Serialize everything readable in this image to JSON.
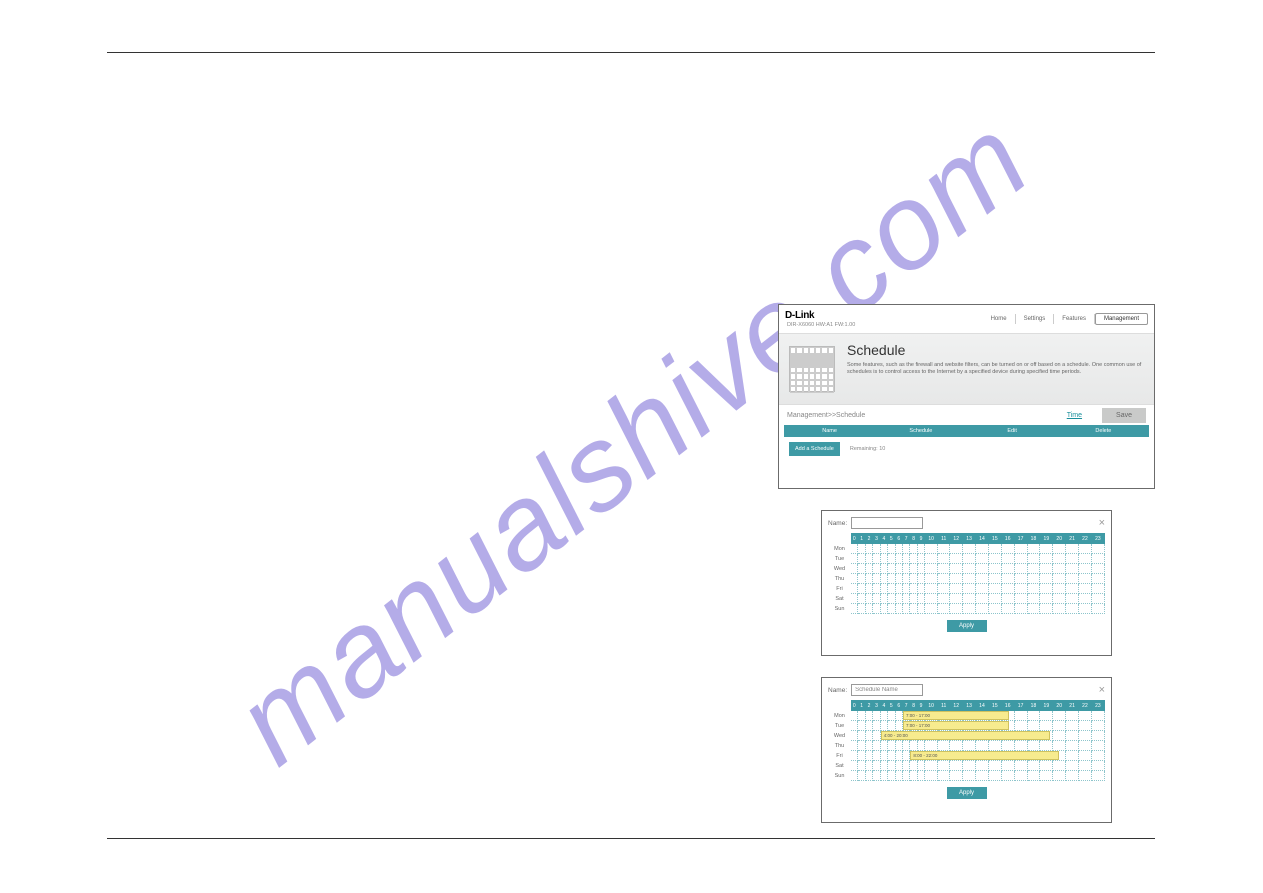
{
  "watermark": "manualshive.com",
  "panel1": {
    "logo": "D-Link",
    "model": "DIR-X6060 HW:A1 FW:1.00",
    "nav": {
      "home": "Home",
      "settings": "Settings",
      "features": "Features",
      "management": "Management"
    },
    "title": "Schedule",
    "description": "Some features, such as the firewall and website filters, can be turned on or off based on a schedule. One common use of schedules is to control access to the Internet by a specified device during specified time periods.",
    "breadcrumb": "Management>>Schedule",
    "time_link": "Time",
    "save_btn": "Save",
    "cols": {
      "name": "Name",
      "schedule": "Schedule",
      "edit": "Edit",
      "delete": "Delete"
    },
    "add_btn": "Add a Schedule",
    "remaining": "Remaining: 10"
  },
  "hours": [
    "0",
    "1",
    "2",
    "3",
    "4",
    "5",
    "6",
    "7",
    "8",
    "9",
    "10",
    "11",
    "12",
    "13",
    "14",
    "15",
    "16",
    "17",
    "18",
    "19",
    "20",
    "21",
    "22",
    "23"
  ],
  "days": [
    "Mon",
    "Tue",
    "Wed",
    "Thu",
    "Fri",
    "Sat",
    "Sun"
  ],
  "panel2": {
    "name_label": "Name:",
    "name_value": "",
    "apply": "Apply"
  },
  "panel3": {
    "name_label": "Name:",
    "name_value": "Schedule Name",
    "apply": "Apply",
    "blocks": {
      "mon": "7:00 - 17:00",
      "tue": "7:00 - 17:00",
      "wed": "4:00 - 20:00",
      "fri": "8:00 - 22:00"
    }
  }
}
